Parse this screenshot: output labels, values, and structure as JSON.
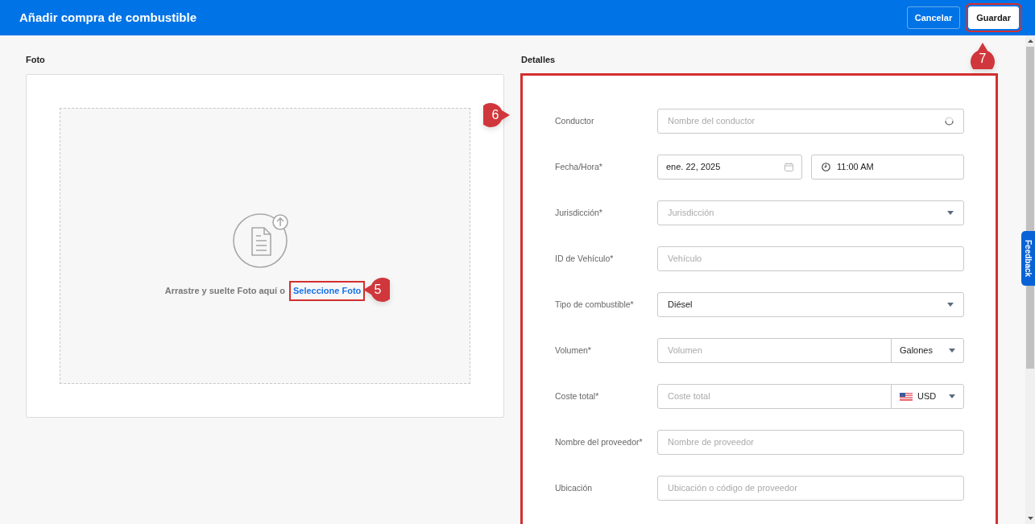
{
  "header": {
    "title": "Añadir compra de combustible",
    "buttons": [
      {
        "label": "Cancelar",
        "kind": "secondary",
        "highlighted": false
      },
      {
        "label": "Guardar",
        "kind": "primary",
        "highlighted": true
      }
    ]
  },
  "photo": {
    "title": "Foto",
    "prompt": "Arrastre y suelte Foto aquí o",
    "link": {
      "label": "Seleccione Foto",
      "highlighted": true
    }
  },
  "details": {
    "title": "Detalles",
    "highlighted": true,
    "fields": [
      {
        "label": "Conductor",
        "kind": "search",
        "placeholder": "Nombre del conductor"
      },
      {
        "label": "Fecha/Hora*",
        "kind": "datetime",
        "date": "ene. 22, 2025",
        "time": "11:00 AM"
      },
      {
        "label": "Jurisdicción*",
        "kind": "select",
        "placeholder": "Jurisdicción"
      },
      {
        "label": "ID de Vehículo*",
        "kind": "text",
        "placeholder": "Vehículo"
      },
      {
        "label": "Tipo de combustible*",
        "kind": "select",
        "value": "Diésel"
      },
      {
        "label": "Volumen*",
        "kind": "unit",
        "placeholder": "Volumen",
        "unit": "Galones"
      },
      {
        "label": "Coste total*",
        "kind": "currency",
        "placeholder": "Coste total",
        "currency": "USD"
      },
      {
        "label": "Nombre del proveedor*",
        "kind": "text",
        "placeholder": "Nombre de proveedor"
      },
      {
        "label": "Ubicación",
        "kind": "text",
        "placeholder": "Ubicación o código de proveedor"
      }
    ]
  },
  "feedback_tab": {
    "label": "Feedback"
  },
  "callouts": [
    {
      "number": "5"
    },
    {
      "number": "6"
    },
    {
      "number": "7"
    }
  ]
}
